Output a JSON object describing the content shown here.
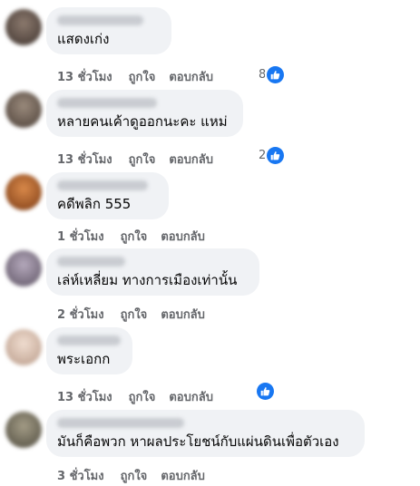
{
  "comments": [
    {
      "text": "แสดงเก่ง",
      "time": "13 ชั่วโมง",
      "like": "ถูกใจ",
      "reply": "ตอบกลับ",
      "reaction_count": "8",
      "avatar_color": "#4a3f3a"
    },
    {
      "text": "หลายคนเค้าดูออกนะคะ แหม่",
      "time": "13 ชั่วโมง",
      "like": "ถูกใจ",
      "reply": "ตอบกลับ",
      "reaction_count": "2",
      "avatar_color": "#5a4e44"
    },
    {
      "text": "คดีพลิก 555",
      "time": "1 ชั่วโมง",
      "like": "ถูกใจ",
      "reply": "ตอบกลับ",
      "reaction_count": "",
      "avatar_color": "#a0521e"
    },
    {
      "text": "เล่ห์เหลี่ยม ทางการเมืองเท่านั้น",
      "time": "2 ชั่วโมง",
      "like": "ถูกใจ",
      "reply": "ตอบกลับ",
      "reaction_count": "",
      "avatar_color": "#8a7e90"
    },
    {
      "text": "พระเอกก",
      "time": "13 ชั่วโมง",
      "like": "ถูกใจ",
      "reply": "ตอบกลับ",
      "reaction_count": "",
      "avatar_color": "#d8c2b4"
    },
    {
      "text": "มันก็คือพวก หาผลประโยชน์กับแผ่นดินเพื่อตัวเอง",
      "time": "3 ชั่วโมง",
      "like": "ถูกใจ",
      "reply": "ตอบกลับ",
      "reaction_count": "",
      "avatar_color": "#6e6a5c"
    }
  ],
  "colors": {
    "bubble": "#f0f2f5",
    "meta_text": "#65676b",
    "like_blue": "#1877f2"
  }
}
